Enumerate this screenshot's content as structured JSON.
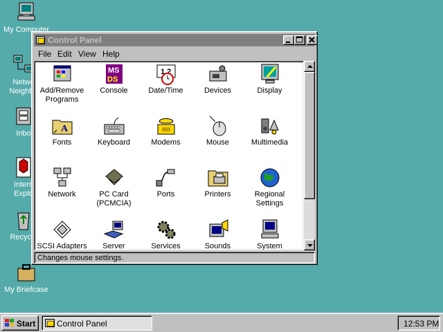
{
  "desktop": {
    "icons": [
      {
        "label": "My Computer",
        "icon": "my-computer-icon"
      },
      {
        "label": "Netwo\nNeighbo",
        "icon": "network-neighborhood-icon"
      },
      {
        "label": "Inbo",
        "icon": "inbox-icon"
      },
      {
        "label": "Intern\nExplo",
        "icon": "internet-explorer-icon"
      },
      {
        "label": "Recycle",
        "icon": "recycle-bin-icon"
      },
      {
        "label": "My Briefcase",
        "icon": "briefcase-icon"
      }
    ]
  },
  "window": {
    "title": "Control Panel",
    "menu": [
      "File",
      "Edit",
      "View",
      "Help"
    ],
    "items": [
      {
        "label": "Add/Remove\nPrograms",
        "icon": "add-remove-programs-icon"
      },
      {
        "label": "Console",
        "icon": "console-icon"
      },
      {
        "label": "Date/Time",
        "icon": "date-time-icon"
      },
      {
        "label": "Devices",
        "icon": "devices-icon"
      },
      {
        "label": "Display",
        "icon": "display-icon"
      },
      {
        "label": "Fonts",
        "icon": "fonts-icon"
      },
      {
        "label": "Keyboard",
        "icon": "keyboard-icon"
      },
      {
        "label": "Modems",
        "icon": "modems-icon"
      },
      {
        "label": "Mouse",
        "icon": "mouse-icon"
      },
      {
        "label": "Multimedia",
        "icon": "multimedia-icon"
      },
      {
        "label": "Network",
        "icon": "network-icon"
      },
      {
        "label": "PC Card\n(PCMCIA)",
        "icon": "pc-card-icon"
      },
      {
        "label": "Ports",
        "icon": "ports-icon"
      },
      {
        "label": "Printers",
        "icon": "printers-icon"
      },
      {
        "label": "Regional\nSettings",
        "icon": "regional-settings-icon"
      },
      {
        "label": "SCSI Adapters",
        "icon": "scsi-adapters-icon"
      },
      {
        "label": "Server",
        "icon": "server-icon"
      },
      {
        "label": "Services",
        "icon": "services-icon"
      },
      {
        "label": "Sounds",
        "icon": "sounds-icon"
      },
      {
        "label": "System",
        "icon": "system-icon"
      }
    ],
    "status": "Changes mouse settings."
  },
  "taskbar": {
    "start_label": "Start",
    "task_label": "Control Panel",
    "clock": "12:53 PM"
  },
  "colors": {
    "desktop": "#55aaaa",
    "face": "#c0c0c0",
    "inactive_title": "#808080"
  }
}
